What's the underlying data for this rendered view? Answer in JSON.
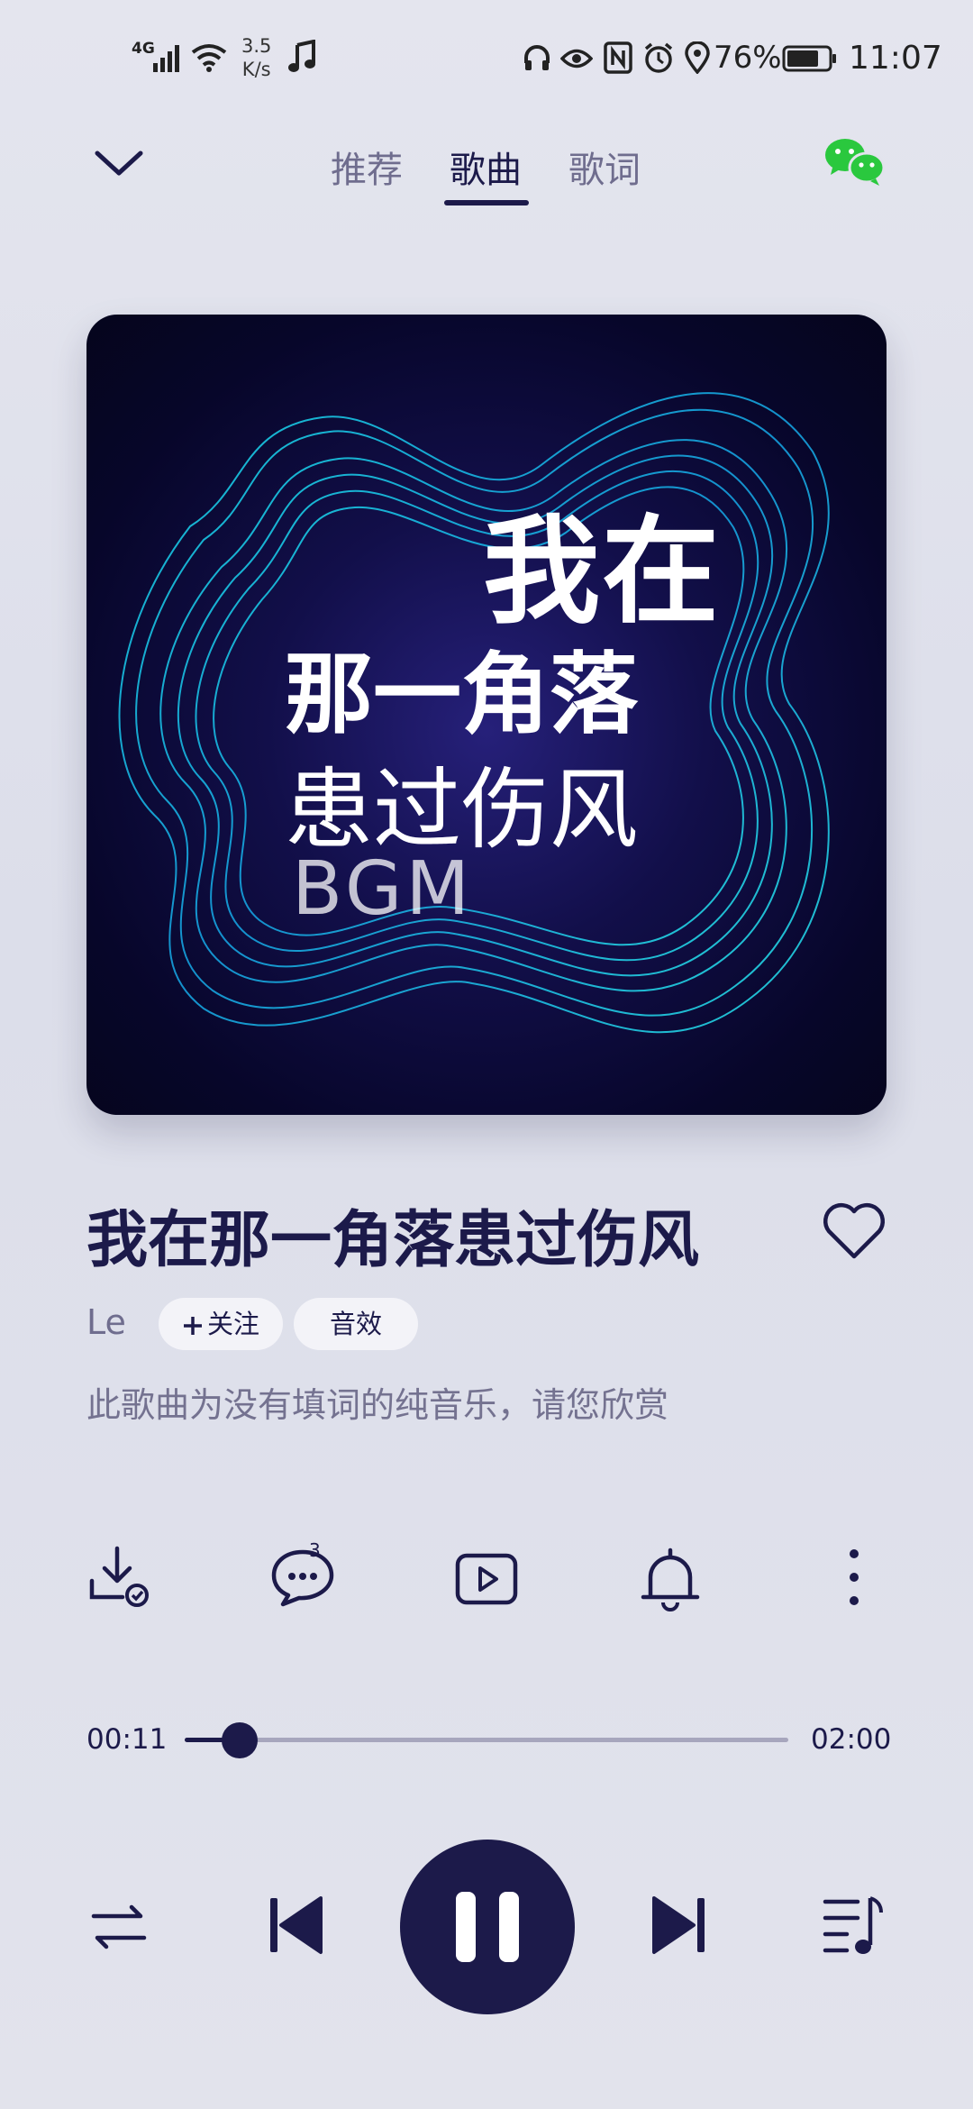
{
  "status_bar": {
    "network": "4G",
    "speed_value": "3.5",
    "speed_unit": "K/s",
    "battery_percent": "76%",
    "time": "11:07",
    "icons": [
      "signal-icon",
      "wifi-icon",
      "music-note-icon",
      "headphones-icon",
      "eye-icon",
      "nfc-icon",
      "alarm-icon",
      "location-icon",
      "battery-icon"
    ]
  },
  "header": {
    "tabs": [
      {
        "label": "推荐",
        "active": false
      },
      {
        "label": "歌曲",
        "active": true
      },
      {
        "label": "歌词",
        "active": false
      }
    ],
    "collapse_icon": "chevron-down-icon",
    "share_icon": "wechat-icon"
  },
  "album_art": {
    "line1": "我在",
    "line2": "那一角落",
    "line3": "患过伤风",
    "line4": "BGM"
  },
  "song": {
    "title": "我在那一角落患过伤风",
    "artist": "Le",
    "follow_label": "关注",
    "effect_label": "音效",
    "description": "此歌曲为没有填词的纯音乐，请您欣赏"
  },
  "actions": {
    "comment_count": "3",
    "icons": [
      "download-icon",
      "comment-icon",
      "video-icon",
      "bell-icon",
      "more-icon"
    ]
  },
  "progress": {
    "current": "00:11",
    "total": "02:00",
    "fraction": 0.0917
  },
  "controls": {
    "icons": [
      "repeat-icon",
      "previous-icon",
      "pause-icon",
      "next-icon",
      "playlist-icon"
    ]
  },
  "colors": {
    "primary": "#1c1a4a",
    "muted": "#6f6d8e",
    "wechat": "#2ac83e",
    "background": "#e2e3ec"
  }
}
